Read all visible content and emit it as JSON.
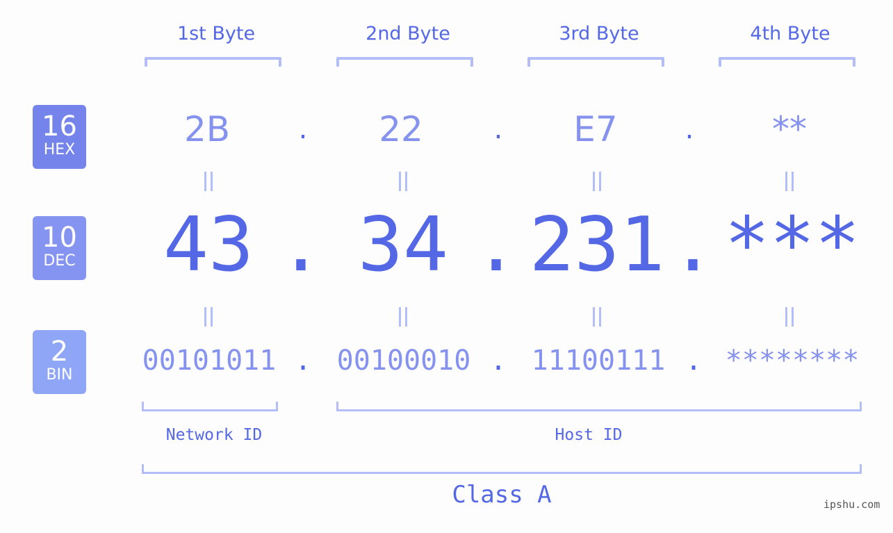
{
  "bytes": {
    "headers": [
      "1st Byte",
      "2nd Byte",
      "3rd Byte",
      "4th Byte"
    ]
  },
  "badges": {
    "hex": {
      "num": "16",
      "label": "HEX",
      "color": "#7584ea"
    },
    "dec": {
      "num": "10",
      "label": "DEC",
      "color": "#8594f0"
    },
    "bin": {
      "num": "2",
      "label": "BIN",
      "color": "#8fa6f7"
    }
  },
  "hex": {
    "values": [
      "2B",
      "22",
      "E7",
      "**"
    ],
    "separator": "."
  },
  "dec": {
    "values": [
      "43",
      "34",
      "231",
      "***"
    ],
    "separator": "."
  },
  "bin": {
    "values": [
      "00101011",
      "00100010",
      "11100111",
      "********"
    ],
    "separator": "."
  },
  "ids": {
    "network": "Network ID",
    "host": "Host ID"
  },
  "class_label": "Class A",
  "watermark": "ipshu.com",
  "colors": {
    "accent": "#5468e6",
    "light": "#8592ee",
    "bracket": "#b3bdf8",
    "background": "#fcfdfc"
  }
}
